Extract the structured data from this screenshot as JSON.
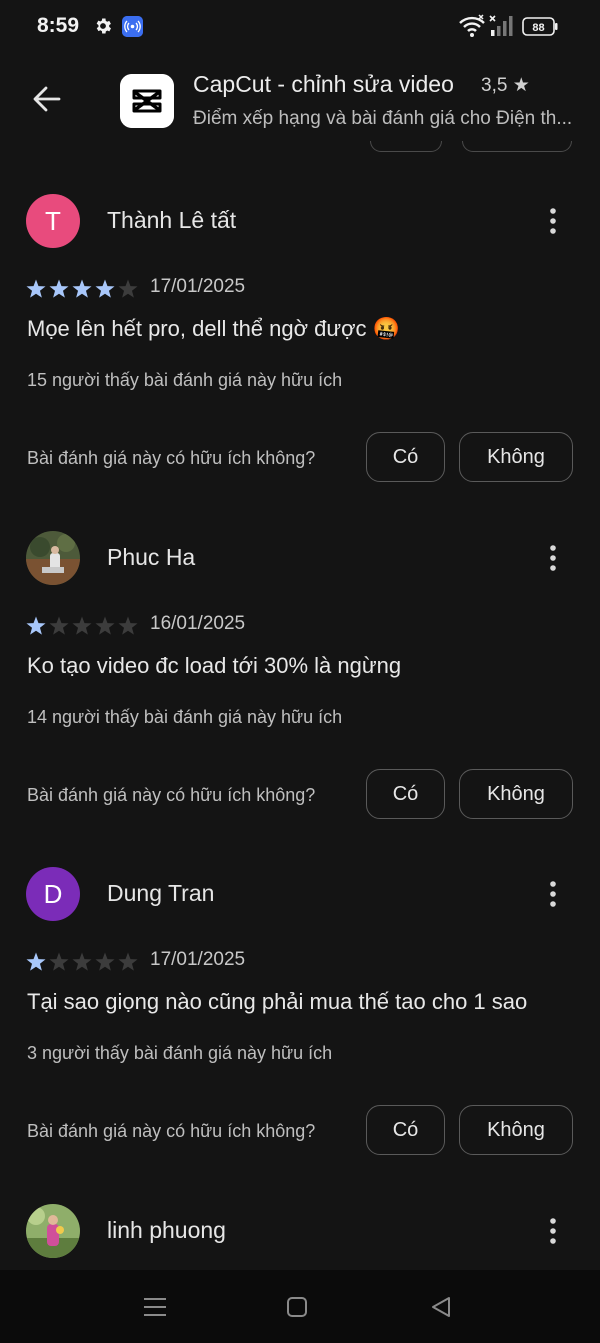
{
  "status_bar": {
    "time": "8:59",
    "battery": "88"
  },
  "header": {
    "app_name": "CapCut - chỉnh sửa video",
    "rating": "3,5 ★",
    "subtitle": "Điểm xếp hạng và bài đánh giá cho Điện th..."
  },
  "reviews": [
    {
      "name": "Thành Lê tất",
      "avatar_letter": "T",
      "avatar_color": "#e84b7d",
      "rating": 4,
      "date": "17/01/2025",
      "text": "Mọe lên hết pro, dell thể ngờ được 🤬",
      "helpful": "15 người thấy bài đánh giá này hữu ích",
      "question": "Bài đánh giá này có hữu ích không?",
      "yes": "Có",
      "no": "Không"
    },
    {
      "name": "Phuc Ha",
      "avatar_letter": "",
      "avatar_color": "#5b4a3a",
      "rating": 1,
      "date": "16/01/2025",
      "text": "Ko tạo video đc load tới 30% là ngừng",
      "helpful": "14 người thấy bài đánh giá này hữu ích",
      "question": "Bài đánh giá này có hữu ích không?",
      "yes": "Có",
      "no": "Không"
    },
    {
      "name": "Dung Tran",
      "avatar_letter": "D",
      "avatar_color": "#7b2cb8",
      "rating": 1,
      "date": "17/01/2025",
      "text": "Tại sao giọng nào cũng phải mua thế tao cho 1 sao",
      "helpful": "3 người thấy bài đánh giá này hữu ích",
      "question": "Bài đánh giá này có hữu ích không?",
      "yes": "Có",
      "no": "Không"
    },
    {
      "name": "linh phuong",
      "avatar_letter": "",
      "avatar_color": "#6c8f4a"
    }
  ],
  "colors": {
    "star_filled": "#a8c7fa",
    "star_empty": "#3c3c3c",
    "background": "#141414"
  }
}
